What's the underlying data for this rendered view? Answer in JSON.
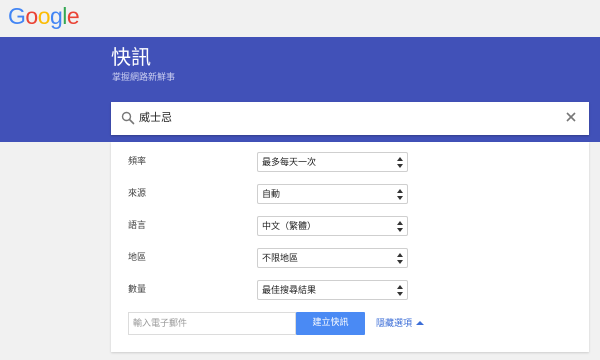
{
  "logo": {
    "letters": [
      "G",
      "o",
      "o",
      "g",
      "l",
      "e"
    ],
    "colors": [
      "#4285f4",
      "#ea4335",
      "#fbbc05",
      "#4285f4",
      "#34a853",
      "#ea4335"
    ]
  },
  "header": {
    "title": "快訊",
    "subtitle": "掌握網路新鮮事"
  },
  "search": {
    "value": "威士忌"
  },
  "options": [
    {
      "label": "頻率",
      "value": "最多每天一次"
    },
    {
      "label": "來源",
      "value": "自動"
    },
    {
      "label": "語言",
      "value": "中文（繁體）"
    },
    {
      "label": "地區",
      "value": "不限地區"
    },
    {
      "label": "數量",
      "value": "最佳搜尋結果"
    }
  ],
  "email": {
    "placeholder": "輸入電子郵件"
  },
  "actions": {
    "create_label": "建立快訊",
    "hide_options_label": "隱藏選項"
  },
  "colors": {
    "banner": "#4151b8",
    "button": "#4a8af4",
    "link": "#3c6ed7"
  }
}
